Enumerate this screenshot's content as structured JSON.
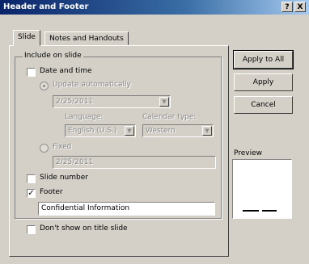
{
  "window": {
    "title": "Header and Footer",
    "help_glyph": "?",
    "close_glyph": "X"
  },
  "tabs": [
    {
      "label": "Slide",
      "active": true
    },
    {
      "label": "Notes and Handouts",
      "active": false
    }
  ],
  "include": {
    "legend": "Include on slide",
    "date_time": {
      "label": "Date and time",
      "checked": false
    },
    "update_auto": {
      "label": "Update automatically",
      "selected": true,
      "value": "2/25/2011"
    },
    "language": {
      "label": "Language:",
      "value": "English (U.S.)"
    },
    "calendar": {
      "label": "Calendar type:",
      "value": "Western"
    },
    "fixed": {
      "label": "Fixed",
      "selected": false,
      "value": "2/25/2011"
    },
    "slide_number": {
      "label": "Slide number",
      "checked": false
    },
    "footer": {
      "label": "Footer",
      "checked": true,
      "value": "Confidential Information"
    }
  },
  "dont_show_title": {
    "label": "Don't show on title slide",
    "checked": false
  },
  "buttons": {
    "apply_all": "Apply to All",
    "apply": "Apply",
    "cancel": "Cancel"
  },
  "preview": {
    "label": "Preview"
  },
  "check_glyph": "✓"
}
